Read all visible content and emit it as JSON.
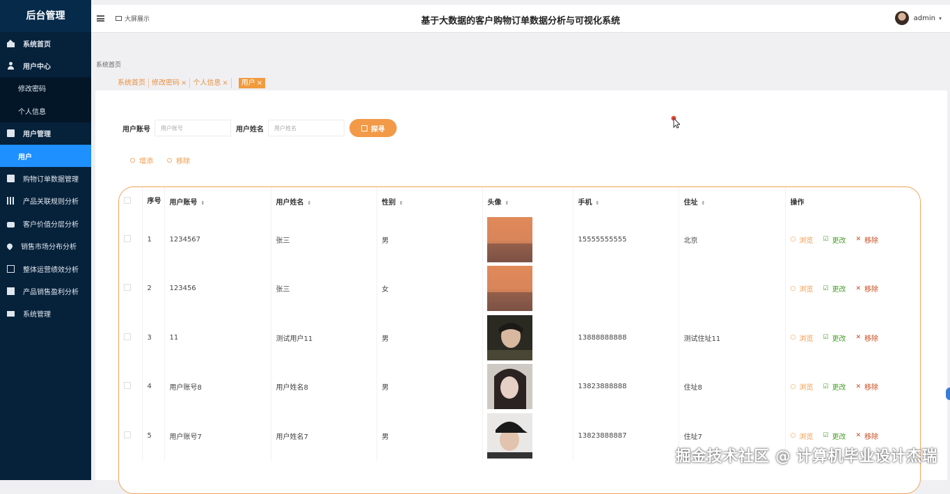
{
  "sidebar": {
    "brand": "后台管理",
    "items": [
      {
        "label": "系统首页",
        "icon": "home-icon"
      },
      {
        "label": "用户中心",
        "icon": "user-icon"
      },
      {
        "label": "修改密码"
      },
      {
        "label": "个人信息"
      },
      {
        "label": "用户管理",
        "icon": "clipboard-icon"
      },
      {
        "label": "用户"
      },
      {
        "label": "购物订单数据管理",
        "icon": "list-icon"
      },
      {
        "label": "产品关联规则分析",
        "icon": "bar-chart-icon"
      },
      {
        "label": "客户价值分层分析",
        "icon": "briefcase-icon"
      },
      {
        "label": "销售市场分布分析",
        "icon": "location-pin-icon"
      },
      {
        "label": "整体运营绩效分析",
        "icon": "copy-icon"
      },
      {
        "label": "产品销售盈利分析",
        "icon": "book-icon"
      },
      {
        "label": "系统管理",
        "icon": "monitor-icon"
      }
    ]
  },
  "topbar": {
    "bigscreen_label": "大屏展示",
    "title": "基于大数据的客户购物订单数据分析与可视化系统",
    "username": "admin"
  },
  "breadcrumb": "系统首页",
  "tags": [
    {
      "label": "系统首页"
    },
    {
      "label": "修改密码",
      "close": "×"
    },
    {
      "label": "个人信息",
      "close": "×"
    },
    {
      "label": "用户",
      "close": "×"
    }
  ],
  "search": {
    "account_label": "用户账号",
    "account_placeholder": "用户账号",
    "name_label": "用户姓名",
    "name_placeholder": "用户姓名",
    "button_label": "探寻"
  },
  "actions": {
    "add_label": "增添",
    "remove_label": "移除"
  },
  "table": {
    "headers": {
      "seq": "序号",
      "account": "用户账号",
      "name": "用户姓名",
      "gender": "性别",
      "avatar": "头像",
      "phone": "手机",
      "address": "住址",
      "ops": "操作"
    },
    "sort_glyph": "⇕",
    "op_labels": {
      "view": "浏览",
      "edit": "更改",
      "del": "移除"
    },
    "rows": [
      {
        "seq": "1",
        "account": "1234567",
        "name": "张三",
        "gender": "男",
        "phone": "15555555555",
        "address": "北京",
        "avatar_style": "sunset"
      },
      {
        "seq": "2",
        "account": "123456",
        "name": "张三",
        "gender": "女",
        "phone": "",
        "address": "",
        "avatar_style": "sunset"
      },
      {
        "seq": "3",
        "account": "11",
        "name": "测试用户11",
        "gender": "男",
        "phone": "13888888888",
        "address": "测试住址11",
        "avatar_style": "portrait-dark"
      },
      {
        "seq": "4",
        "account": "用户账号8",
        "name": "用户姓名8",
        "gender": "男",
        "phone": "13823888888",
        "address": "住址8",
        "avatar_style": "portrait-girl"
      },
      {
        "seq": "5",
        "account": "用户账号7",
        "name": "用户姓名7",
        "gender": "男",
        "phone": "13823888887",
        "address": "住址7",
        "avatar_style": "portrait-cap"
      }
    ]
  },
  "watermark": "掘金技术社区 @ 计算机毕业设计杰瑞",
  "colors": {
    "sidebar_bg": "#06213a",
    "active_item": "#1e90ff",
    "accent": "#f29a48",
    "edit_green": "#4aa02c",
    "delete_red": "#c84b1f"
  }
}
